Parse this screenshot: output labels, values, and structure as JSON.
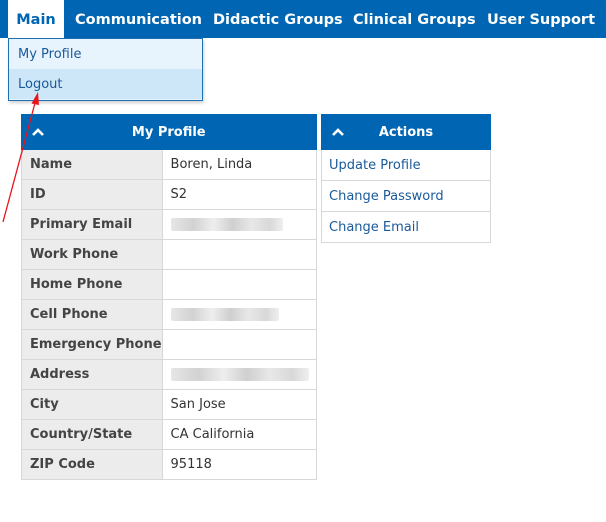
{
  "nav": {
    "items": [
      {
        "label": "Main",
        "active": true
      },
      {
        "label": "Communication"
      },
      {
        "label": "Didactic Groups"
      },
      {
        "label": "Clinical Groups"
      },
      {
        "label": "User Support"
      }
    ]
  },
  "dropdown": {
    "items": [
      {
        "label": "My Profile"
      },
      {
        "label": "Logout",
        "highlighted": true
      }
    ]
  },
  "profile": {
    "title": "My Profile",
    "collapse_icon": "chevron-up-icon",
    "rows": [
      {
        "label": "Name",
        "value": "Boren, Linda"
      },
      {
        "label": "ID",
        "value": "S2"
      },
      {
        "label": "Primary Email",
        "value": "",
        "redacted": true
      },
      {
        "label": "Work Phone",
        "value": ""
      },
      {
        "label": "Home Phone",
        "value": ""
      },
      {
        "label": "Cell Phone",
        "value": "",
        "redacted": true
      },
      {
        "label": "Emergency Phone",
        "value": ""
      },
      {
        "label": "Address",
        "value": "",
        "redacted": true
      },
      {
        "label": "City",
        "value": "San Jose"
      },
      {
        "label": "Country/State",
        "value": "CA California"
      },
      {
        "label": "ZIP Code",
        "value": "95118"
      }
    ]
  },
  "actions": {
    "title": "Actions",
    "collapse_icon": "chevron-up-icon",
    "items": [
      {
        "label": "Update Profile"
      },
      {
        "label": "Change Password"
      },
      {
        "label": "Change Email"
      }
    ]
  },
  "colors": {
    "brand_blue": "#0066b3",
    "link_blue": "#1a5a9a",
    "annotation_arrow": "#e8141c"
  },
  "annotation": {
    "icon": "red-arrow-icon"
  }
}
